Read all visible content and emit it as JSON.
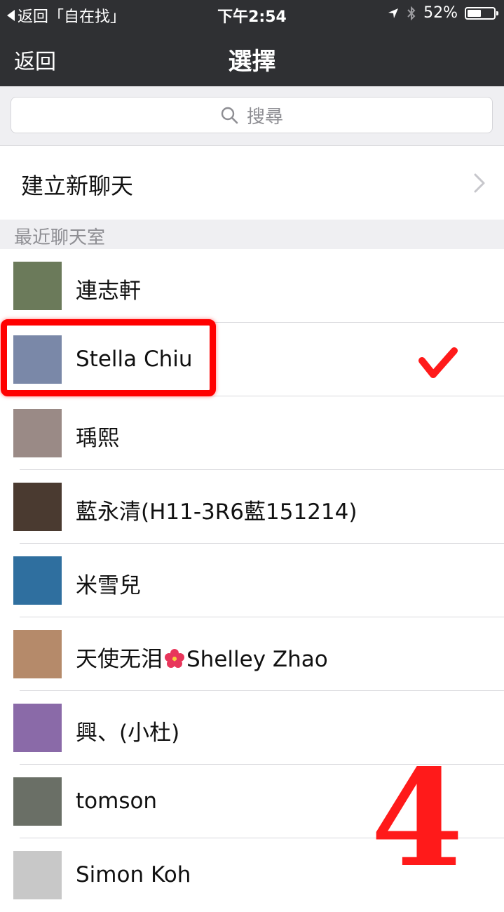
{
  "status_bar": {
    "back_app": "返回「自在找」",
    "time": "下午2:54",
    "battery_percent": "52%",
    "battery_level": 0.52
  },
  "nav": {
    "back_label": "返回",
    "title": "選擇"
  },
  "search": {
    "placeholder": "搜尋"
  },
  "new_chat": {
    "label": "建立新聊天"
  },
  "section": {
    "label": "最近聊天室"
  },
  "contacts": [
    {
      "name": "連志軒",
      "avatar_color": "#6b7a5a"
    },
    {
      "name": "Stella Chiu",
      "avatar_color": "#7a88a8"
    },
    {
      "name": "瑀熙",
      "avatar_color": "#9a8a86"
    },
    {
      "name": "藍永清(H11-3R6藍151214)",
      "avatar_color": "#4a3a30"
    },
    {
      "name": "米雪兒",
      "avatar_color": "#2f6f9f"
    },
    {
      "name_before": "天使无泪",
      "name_after": "Shelley Zhao",
      "avatar_color": "#b58a6a"
    },
    {
      "name": "興、(小杜)",
      "avatar_color": "#8a6aa8"
    },
    {
      "name": "tomson",
      "avatar_color": "#6a6f66"
    },
    {
      "name": "Simon Koh",
      "avatar_color": "#c8c8c8"
    }
  ],
  "annotation": {
    "step_number": "4",
    "color": "#ff0000"
  }
}
